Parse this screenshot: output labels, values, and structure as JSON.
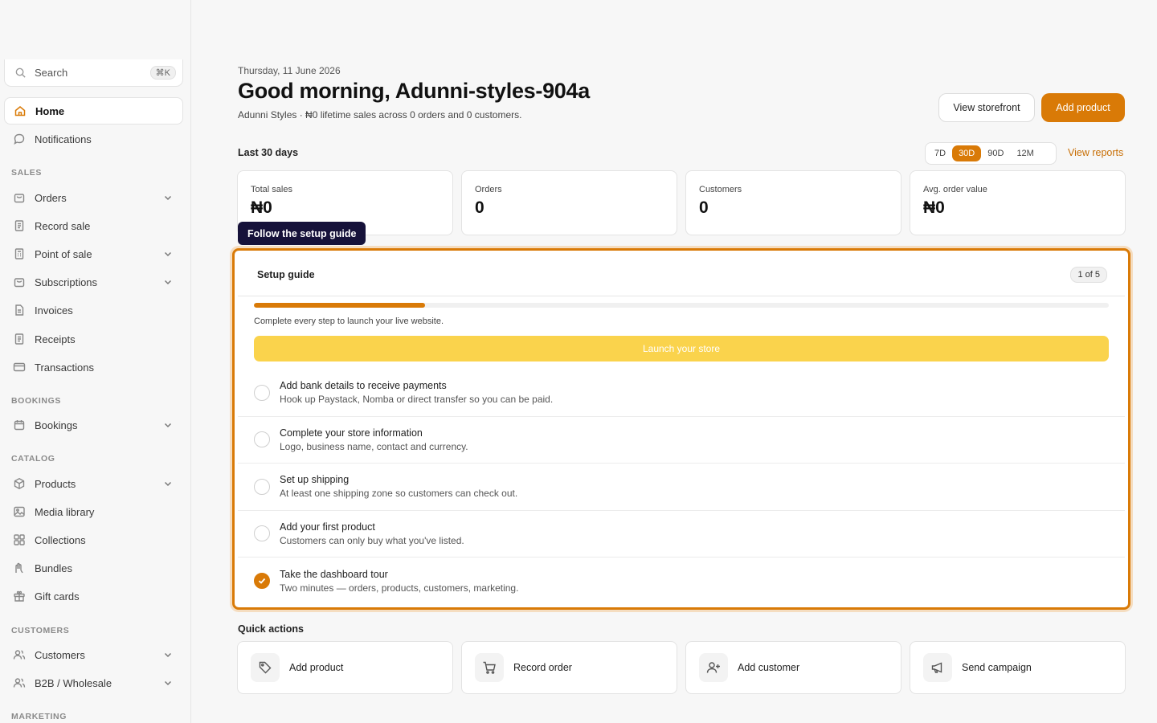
{
  "sidebar": {
    "search": {
      "label": "Search",
      "shortcut": "⌘K"
    },
    "top_items": [
      {
        "label": "Home",
        "icon": "home-icon",
        "active": true
      },
      {
        "label": "Notifications",
        "icon": "chat-bubble-icon"
      }
    ],
    "sections": [
      {
        "title": "SALES",
        "items": [
          {
            "label": "Orders",
            "icon": "bag-icon",
            "expandable": true
          },
          {
            "label": "Record sale",
            "icon": "receipt-icon"
          },
          {
            "label": "Point of sale",
            "icon": "register-icon",
            "expandable": true
          },
          {
            "label": "Subscriptions",
            "icon": "bag-icon",
            "expandable": true
          },
          {
            "label": "Invoices",
            "icon": "document-icon"
          },
          {
            "label": "Receipts",
            "icon": "receipt-icon"
          },
          {
            "label": "Transactions",
            "icon": "card-icon"
          }
        ]
      },
      {
        "title": "BOOKINGS",
        "items": [
          {
            "label": "Bookings",
            "icon": "calendar-icon",
            "expandable": true
          }
        ]
      },
      {
        "title": "CATALOG",
        "items": [
          {
            "label": "Products",
            "icon": "box-icon",
            "expandable": true
          },
          {
            "label": "Media library",
            "icon": "image-icon"
          },
          {
            "label": "Collections",
            "icon": "grid-icon"
          },
          {
            "label": "Bundles",
            "icon": "bundle-icon"
          },
          {
            "label": "Gift cards",
            "icon": "gift-icon"
          }
        ]
      },
      {
        "title": "CUSTOMERS",
        "items": [
          {
            "label": "Customers",
            "icon": "users-icon",
            "expandable": true
          },
          {
            "label": "B2B / Wholesale",
            "icon": "users-icon",
            "expandable": true
          }
        ]
      },
      {
        "title": "MARKETING",
        "items": []
      }
    ]
  },
  "header": {
    "date": "Thursday, 11 June 2026",
    "greeting": "Good morning, Adunni-styles-904a",
    "subline": "Adunni Styles · ₦0 lifetime sales across 0 orders and 0 customers.",
    "view_storefront": "View storefront",
    "add_product": "Add product"
  },
  "stats_bar": {
    "period_label": "Last 30 days",
    "ranges": [
      "7D",
      "30D",
      "90D",
      "12M"
    ],
    "selected_range": "30D",
    "view_reports": "View reports"
  },
  "stats": [
    {
      "label": "Total sales",
      "value": "₦0"
    },
    {
      "label": "Orders",
      "value": "0"
    },
    {
      "label": "Customers",
      "value": "0"
    },
    {
      "label": "Avg. order value",
      "value": "₦0"
    }
  ],
  "tooltip": "Follow the setup guide",
  "setup_guide": {
    "title": "Setup guide",
    "count": "1 of 5",
    "progress": 0.2,
    "note": "Complete every step to launch your live website.",
    "launch_label": "Launch your store",
    "steps": [
      {
        "title": "Add bank details to receive payments",
        "desc": "Hook up Paystack, Nomba or direct transfer so you can be paid.",
        "done": false
      },
      {
        "title": "Complete your store information",
        "desc": "Logo, business name, contact and currency.",
        "done": false
      },
      {
        "title": "Set up shipping",
        "desc": "At least one shipping zone so customers can check out.",
        "done": false
      },
      {
        "title": "Add your first product",
        "desc": "Customers can only buy what you've listed.",
        "done": false
      },
      {
        "title": "Take the dashboard tour",
        "desc": "Two minutes — orders, products, customers, marketing.",
        "done": true
      }
    ]
  },
  "quick_actions": {
    "title": "Quick actions",
    "items": [
      {
        "label": "Add product",
        "icon": "tag-icon"
      },
      {
        "label": "Record order",
        "icon": "cart-icon"
      },
      {
        "label": "Add customer",
        "icon": "user-plus-icon"
      },
      {
        "label": "Send campaign",
        "icon": "megaphone-icon"
      }
    ]
  },
  "colors": {
    "accent": "#d97a07",
    "launch": "#fad34c",
    "tooltip": "#16123a"
  }
}
